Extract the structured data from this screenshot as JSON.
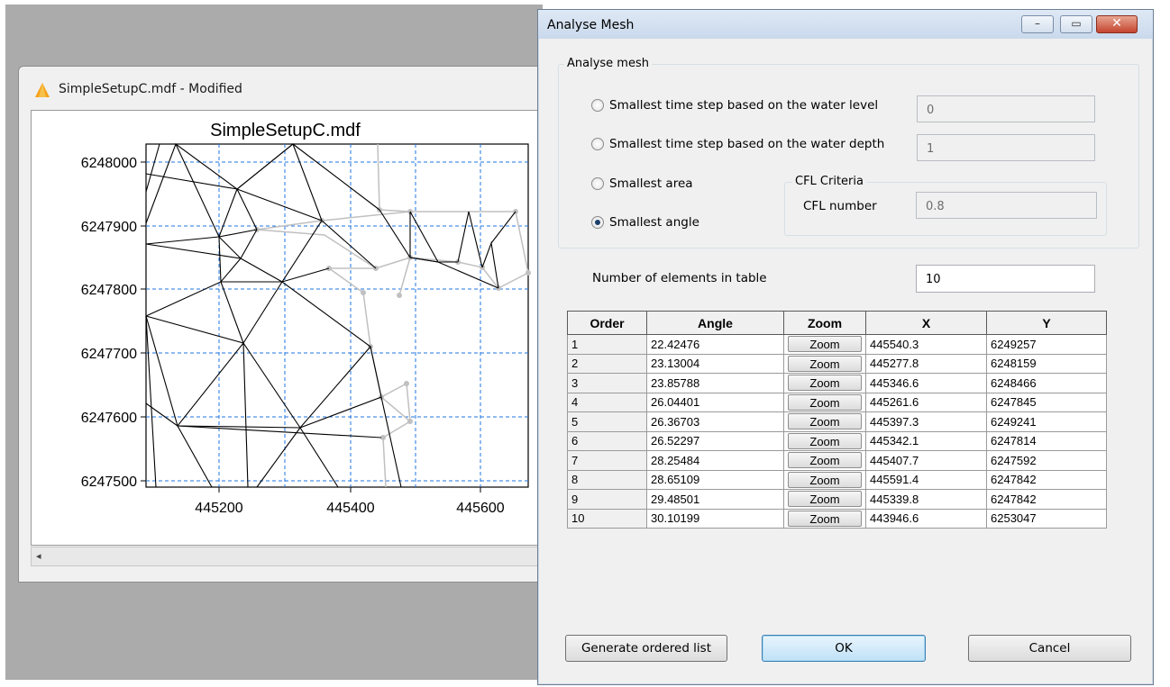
{
  "bg_window": {
    "title": "SimpleSetupC.mdf - Modified",
    "plot_title": "SimpleSetupC.mdf",
    "scroll_left_icon": "◂",
    "y_ticks": [
      "6248000",
      "6247900",
      "6247800",
      "6247700",
      "6247600",
      "6247500"
    ],
    "x_ticks": [
      "445200",
      "445400",
      "445600"
    ]
  },
  "dialog": {
    "title": "Analyse Mesh",
    "window_buttons": {
      "minimize": "–",
      "maximize": "▭",
      "close": "✕"
    },
    "group_title": "Analyse mesh",
    "options": [
      {
        "label": "Smallest time step based on the water level",
        "value": "0",
        "checked": false
      },
      {
        "label": "Smallest time step based on the water depth",
        "value": "1",
        "checked": false
      },
      {
        "label": "Smallest area",
        "checked": false
      },
      {
        "label": "Smallest angle",
        "checked": true
      }
    ],
    "cfl": {
      "title": "CFL Criteria",
      "label": "CFL number",
      "value": "0.8"
    },
    "num_elements": {
      "label": "Number of elements in table",
      "value": "10"
    },
    "table": {
      "headers": [
        "Order",
        "Angle",
        "Zoom",
        "X",
        "Y"
      ],
      "rows": [
        {
          "order": "1",
          "angle": "22.42476",
          "zoom": "Zoom",
          "x": "445540.3",
          "y": "6249257"
        },
        {
          "order": "2",
          "angle": "23.13004",
          "zoom": "Zoom",
          "x": "445277.8",
          "y": "6248159"
        },
        {
          "order": "3",
          "angle": "23.85788",
          "zoom": "Zoom",
          "x": "445346.6",
          "y": "6248466"
        },
        {
          "order": "4",
          "angle": "26.04401",
          "zoom": "Zoom",
          "x": "445261.6",
          "y": "6247845"
        },
        {
          "order": "5",
          "angle": "26.36703",
          "zoom": "Zoom",
          "x": "445397.3",
          "y": "6249241"
        },
        {
          "order": "6",
          "angle": "26.52297",
          "zoom": "Zoom",
          "x": "445342.1",
          "y": "6247814"
        },
        {
          "order": "7",
          "angle": "28.25484",
          "zoom": "Zoom",
          "x": "445407.7",
          "y": "6247592"
        },
        {
          "order": "8",
          "angle": "28.65109",
          "zoom": "Zoom",
          "x": "445591.4",
          "y": "6247842"
        },
        {
          "order": "9",
          "angle": "29.48501",
          "zoom": "Zoom",
          "x": "445339.8",
          "y": "6247842"
        },
        {
          "order": "10",
          "angle": "30.10199",
          "zoom": "Zoom",
          "x": "443946.6",
          "y": "6253047"
        }
      ]
    },
    "buttons": {
      "generate": "Generate ordered list",
      "ok": "OK",
      "cancel": "Cancel"
    }
  },
  "colors": {
    "mesh_line": "#000000",
    "mesh_gray": "#c0c0c0",
    "grid": "#1f74e0",
    "title_bar": "#d3e1f0"
  }
}
